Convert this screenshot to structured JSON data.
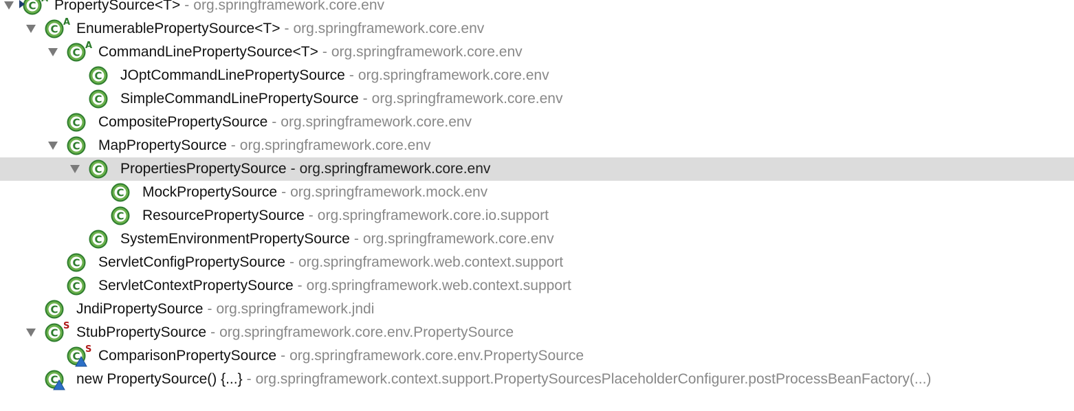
{
  "tree": {
    "rows": [
      {
        "name": "PropertySource<T>",
        "pkg": "org.springframework.core.env",
        "depth": 0,
        "arrow": true,
        "mod": "A",
        "lock": true
      },
      {
        "name": "EnumerablePropertySource<T>",
        "pkg": "org.springframework.core.env",
        "depth": 1,
        "arrow": true,
        "mod": "A"
      },
      {
        "name": "CommandLinePropertySource<T>",
        "pkg": "org.springframework.core.env",
        "depth": 2,
        "arrow": true,
        "mod": "A"
      },
      {
        "name": "JOptCommandLinePropertySource",
        "pkg": "org.springframework.core.env",
        "depth": 3,
        "arrow": false
      },
      {
        "name": "SimpleCommandLinePropertySource",
        "pkg": "org.springframework.core.env",
        "depth": 3,
        "arrow": false
      },
      {
        "name": "CompositePropertySource",
        "pkg": "org.springframework.core.env",
        "depth": 2,
        "arrow": false
      },
      {
        "name": "MapPropertySource",
        "pkg": "org.springframework.core.env",
        "depth": 2,
        "arrow": true
      },
      {
        "name": "PropertiesPropertySource",
        "pkg": "org.springframework.core.env",
        "depth": 3,
        "arrow": true,
        "selected": true
      },
      {
        "name": "MockPropertySource",
        "pkg": "org.springframework.mock.env",
        "depth": 4,
        "arrow": false
      },
      {
        "name": "ResourcePropertySource",
        "pkg": "org.springframework.core.io.support",
        "depth": 4,
        "arrow": false
      },
      {
        "name": "SystemEnvironmentPropertySource",
        "pkg": "org.springframework.core.env",
        "depth": 3,
        "arrow": false
      },
      {
        "name": "ServletConfigPropertySource",
        "pkg": "org.springframework.web.context.support",
        "depth": 2,
        "arrow": false
      },
      {
        "name": "ServletContextPropertySource",
        "pkg": "org.springframework.web.context.support",
        "depth": 2,
        "arrow": false
      },
      {
        "name": "JndiPropertySource",
        "pkg": "org.springframework.jndi",
        "depth": 1,
        "arrow": false
      },
      {
        "name": "StubPropertySource",
        "pkg": "org.springframework.core.env.PropertySource",
        "depth": 1,
        "arrow": true,
        "mod": "S"
      },
      {
        "name": "ComparisonPropertySource",
        "pkg": "org.springframework.core.env.PropertySource",
        "depth": 2,
        "arrow": false,
        "mod": "S",
        "anon": true
      },
      {
        "name": "new PropertySource() {...}",
        "pkg": "org.springframework.context.support.PropertySourcesPlaceholderConfigurer.postProcessBeanFactory(...)",
        "depth": 1,
        "arrow": false,
        "anon": true
      }
    ],
    "separator": "-",
    "class_icon_letter": "C"
  },
  "colors": {
    "class_icon_fill": "#6ab04c",
    "class_icon_ring": "#2e7d2e",
    "abstract_mark": "#2a7a2a",
    "static_mark": "#b01b1b",
    "anon_triangle": "#2b6fc6",
    "selection": "#dcdcdc",
    "package_text": "#888888"
  }
}
